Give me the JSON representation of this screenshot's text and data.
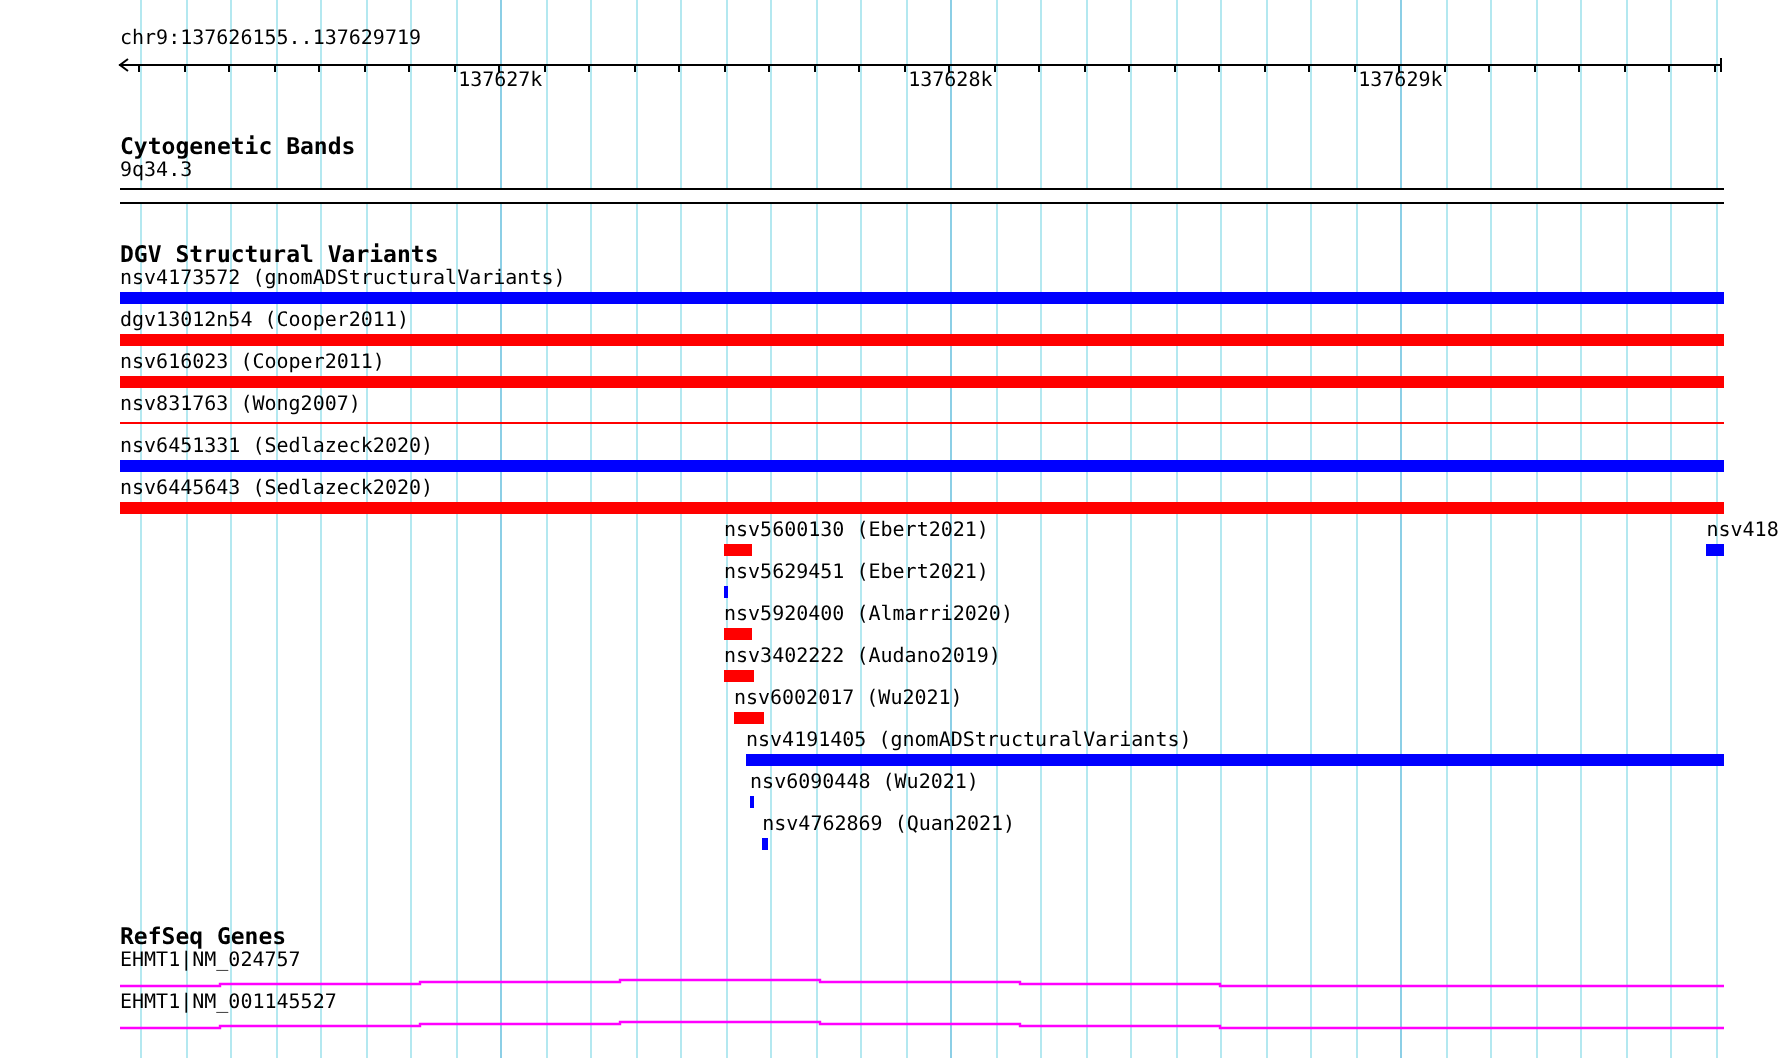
{
  "ruler": {
    "region": "chr9:137626155..137629719",
    "xticks": [
      {
        "label": "137627k"
      },
      {
        "label": "137628k"
      },
      {
        "label": "137629k"
      }
    ]
  },
  "tracks": [
    {
      "kind": "cytoband",
      "title": "Cytogenetic Bands",
      "bands": [
        {
          "label": "9q34.3"
        }
      ]
    },
    {
      "kind": "variants",
      "title": "DGV Structural Variants",
      "rows": [
        {
          "features": [
            {
              "label": "nsv4173572 (gnomADStructuralVariants)",
              "kind": "bar",
              "color": "#0000ff"
            }
          ]
        },
        {
          "features": [
            {
              "label": "dgv13012n54 (Cooper2011)",
              "kind": "bar",
              "color": "#ff0000"
            }
          ]
        },
        {
          "features": [
            {
              "label": "nsv616023 (Cooper2011)",
              "kind": "bar",
              "color": "#ff0000"
            }
          ]
        },
        {
          "features": [
            {
              "label": "nsv831763 (Wong2007)",
              "kind": "line",
              "color": "#ff0000"
            }
          ]
        },
        {
          "features": [
            {
              "label": "nsv6451331 (Sedlazeck2020)",
              "kind": "bar",
              "color": "#0000ff"
            }
          ]
        },
        {
          "features": [
            {
              "label": "nsv6445643 (Sedlazeck2020)",
              "kind": "bar",
              "color": "#ff0000"
            }
          ]
        },
        {
          "features": [
            {
              "label": "nsv5600130 (Ebert2021)",
              "kind": "bar",
              "color": "#ff0000"
            },
            {
              "label": "nsv418",
              "kind": "bar",
              "color": "#0000ff"
            }
          ]
        },
        {
          "features": [
            {
              "label": "nsv5629451 (Ebert2021)",
              "kind": "bar",
              "color": "#0000ff"
            }
          ]
        },
        {
          "features": [
            {
              "label": "nsv5920400 (Almarri2020)",
              "kind": "bar",
              "color": "#ff0000"
            }
          ]
        },
        {
          "features": [
            {
              "label": "nsv3402222 (Audano2019)",
              "kind": "bar",
              "color": "#ff0000"
            }
          ]
        },
        {
          "features": [
            {
              "label": "nsv6002017 (Wu2021)",
              "kind": "bar",
              "color": "#ff0000"
            }
          ]
        },
        {
          "features": [
            {
              "label": "nsv4191405 (gnomADStructuralVariants)",
              "kind": "bar",
              "color": "#0000ff"
            }
          ]
        },
        {
          "features": [
            {
              "label": "nsv6090448 (Wu2021)",
              "kind": "bar",
              "color": "#0000ff"
            }
          ]
        },
        {
          "features": [
            {
              "label": "nsv4762869 (Quan2021)",
              "kind": "bar",
              "color": "#0000ff"
            }
          ]
        }
      ]
    },
    {
      "kind": "genes",
      "title": "RefSeq Genes",
      "genes": [
        {
          "label": "EHMT1|NM_024757"
        },
        {
          "label": "EHMT1|NM_001145527"
        }
      ]
    }
  ]
}
